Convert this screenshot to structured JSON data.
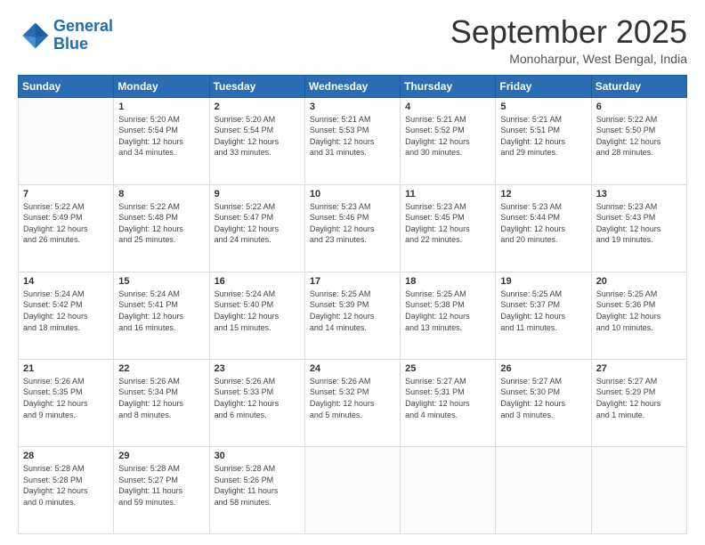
{
  "header": {
    "logo_line1": "General",
    "logo_line2": "Blue",
    "month_title": "September 2025",
    "location": "Monoharpur, West Bengal, India"
  },
  "weekdays": [
    "Sunday",
    "Monday",
    "Tuesday",
    "Wednesday",
    "Thursday",
    "Friday",
    "Saturday"
  ],
  "weeks": [
    [
      {
        "day": "",
        "info": ""
      },
      {
        "day": "1",
        "info": "Sunrise: 5:20 AM\nSunset: 5:54 PM\nDaylight: 12 hours\nand 34 minutes."
      },
      {
        "day": "2",
        "info": "Sunrise: 5:20 AM\nSunset: 5:54 PM\nDaylight: 12 hours\nand 33 minutes."
      },
      {
        "day": "3",
        "info": "Sunrise: 5:21 AM\nSunset: 5:53 PM\nDaylight: 12 hours\nand 31 minutes."
      },
      {
        "day": "4",
        "info": "Sunrise: 5:21 AM\nSunset: 5:52 PM\nDaylight: 12 hours\nand 30 minutes."
      },
      {
        "day": "5",
        "info": "Sunrise: 5:21 AM\nSunset: 5:51 PM\nDaylight: 12 hours\nand 29 minutes."
      },
      {
        "day": "6",
        "info": "Sunrise: 5:22 AM\nSunset: 5:50 PM\nDaylight: 12 hours\nand 28 minutes."
      }
    ],
    [
      {
        "day": "7",
        "info": "Sunrise: 5:22 AM\nSunset: 5:49 PM\nDaylight: 12 hours\nand 26 minutes."
      },
      {
        "day": "8",
        "info": "Sunrise: 5:22 AM\nSunset: 5:48 PM\nDaylight: 12 hours\nand 25 minutes."
      },
      {
        "day": "9",
        "info": "Sunrise: 5:22 AM\nSunset: 5:47 PM\nDaylight: 12 hours\nand 24 minutes."
      },
      {
        "day": "10",
        "info": "Sunrise: 5:23 AM\nSunset: 5:46 PM\nDaylight: 12 hours\nand 23 minutes."
      },
      {
        "day": "11",
        "info": "Sunrise: 5:23 AM\nSunset: 5:45 PM\nDaylight: 12 hours\nand 22 minutes."
      },
      {
        "day": "12",
        "info": "Sunrise: 5:23 AM\nSunset: 5:44 PM\nDaylight: 12 hours\nand 20 minutes."
      },
      {
        "day": "13",
        "info": "Sunrise: 5:23 AM\nSunset: 5:43 PM\nDaylight: 12 hours\nand 19 minutes."
      }
    ],
    [
      {
        "day": "14",
        "info": "Sunrise: 5:24 AM\nSunset: 5:42 PM\nDaylight: 12 hours\nand 18 minutes."
      },
      {
        "day": "15",
        "info": "Sunrise: 5:24 AM\nSunset: 5:41 PM\nDaylight: 12 hours\nand 16 minutes."
      },
      {
        "day": "16",
        "info": "Sunrise: 5:24 AM\nSunset: 5:40 PM\nDaylight: 12 hours\nand 15 minutes."
      },
      {
        "day": "17",
        "info": "Sunrise: 5:25 AM\nSunset: 5:39 PM\nDaylight: 12 hours\nand 14 minutes."
      },
      {
        "day": "18",
        "info": "Sunrise: 5:25 AM\nSunset: 5:38 PM\nDaylight: 12 hours\nand 13 minutes."
      },
      {
        "day": "19",
        "info": "Sunrise: 5:25 AM\nSunset: 5:37 PM\nDaylight: 12 hours\nand 11 minutes."
      },
      {
        "day": "20",
        "info": "Sunrise: 5:25 AM\nSunset: 5:36 PM\nDaylight: 12 hours\nand 10 minutes."
      }
    ],
    [
      {
        "day": "21",
        "info": "Sunrise: 5:26 AM\nSunset: 5:35 PM\nDaylight: 12 hours\nand 9 minutes."
      },
      {
        "day": "22",
        "info": "Sunrise: 5:26 AM\nSunset: 5:34 PM\nDaylight: 12 hours\nand 8 minutes."
      },
      {
        "day": "23",
        "info": "Sunrise: 5:26 AM\nSunset: 5:33 PM\nDaylight: 12 hours\nand 6 minutes."
      },
      {
        "day": "24",
        "info": "Sunrise: 5:26 AM\nSunset: 5:32 PM\nDaylight: 12 hours\nand 5 minutes."
      },
      {
        "day": "25",
        "info": "Sunrise: 5:27 AM\nSunset: 5:31 PM\nDaylight: 12 hours\nand 4 minutes."
      },
      {
        "day": "26",
        "info": "Sunrise: 5:27 AM\nSunset: 5:30 PM\nDaylight: 12 hours\nand 3 minutes."
      },
      {
        "day": "27",
        "info": "Sunrise: 5:27 AM\nSunset: 5:29 PM\nDaylight: 12 hours\nand 1 minute."
      }
    ],
    [
      {
        "day": "28",
        "info": "Sunrise: 5:28 AM\nSunset: 5:28 PM\nDaylight: 12 hours\nand 0 minutes."
      },
      {
        "day": "29",
        "info": "Sunrise: 5:28 AM\nSunset: 5:27 PM\nDaylight: 11 hours\nand 59 minutes."
      },
      {
        "day": "30",
        "info": "Sunrise: 5:28 AM\nSunset: 5:26 PM\nDaylight: 11 hours\nand 58 minutes."
      },
      {
        "day": "",
        "info": ""
      },
      {
        "day": "",
        "info": ""
      },
      {
        "day": "",
        "info": ""
      },
      {
        "day": "",
        "info": ""
      }
    ]
  ]
}
